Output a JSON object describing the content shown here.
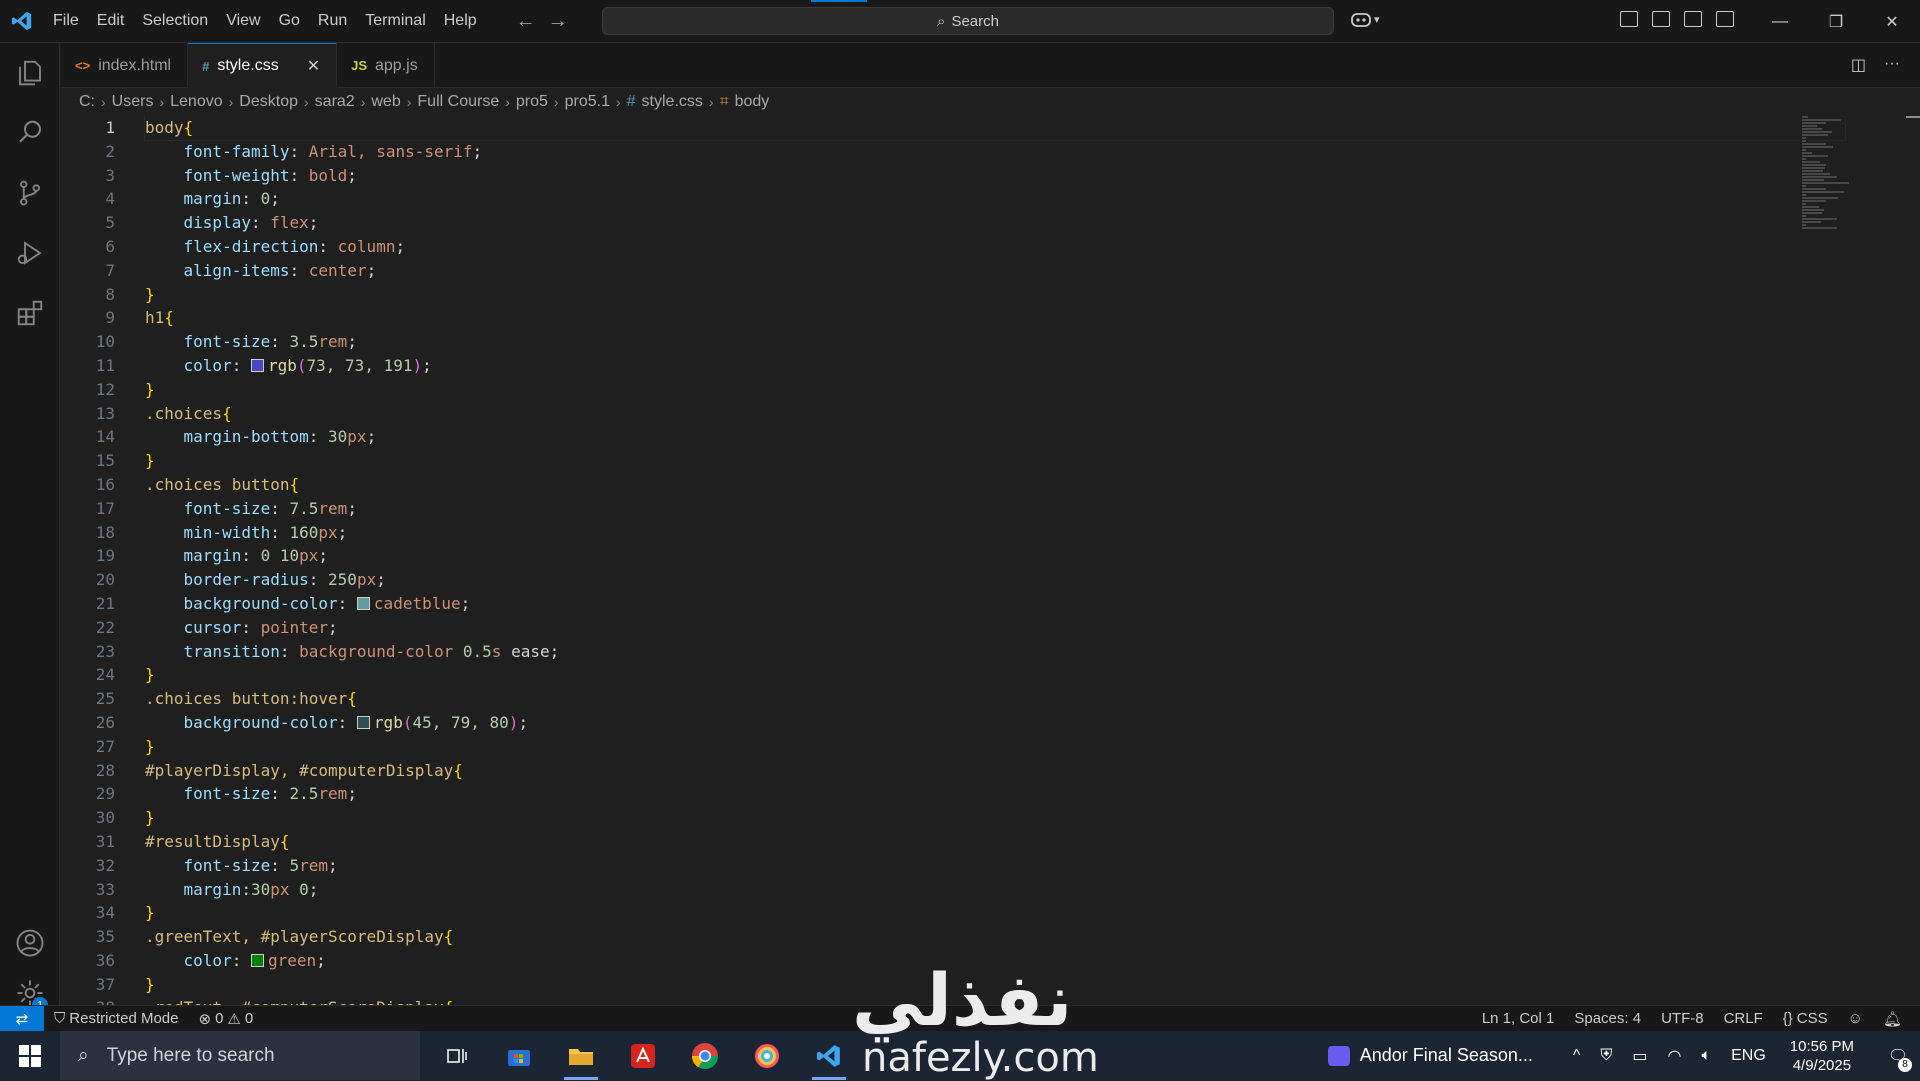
{
  "menu": [
    "File",
    "Edit",
    "Selection",
    "View",
    "Go",
    "Run",
    "Terminal",
    "Help"
  ],
  "command_center": {
    "label": "Search"
  },
  "tabs": [
    {
      "label": "index.html",
      "icon": "<>",
      "icon_color": "#e37933",
      "active": false
    },
    {
      "label": "style.css",
      "icon": "#",
      "icon_color": "#519aba",
      "active": true
    },
    {
      "label": "app.js",
      "icon": "JS",
      "icon_color": "#cbcb41",
      "active": false
    }
  ],
  "breadcrumb": [
    "C:",
    "Users",
    "Lenovo",
    "Desktop",
    "sara2",
    "web",
    "Full Course",
    "pro5",
    "pro5.1",
    "style.css",
    "body"
  ],
  "code_lines": [
    "body{",
    "    font-family: Arial, sans-serif;",
    "    font-weight: bold;",
    "    margin: 0;",
    "    display: flex;",
    "    flex-direction: column;",
    "    align-items: center;",
    "}",
    "h1{",
    "    font-size: 3.5rem;",
    "    color: rgb(73, 73, 191);",
    "}",
    ".choices{",
    "    margin-bottom: 30px;",
    "}",
    ".choices button{",
    "    font-size: 7.5rem;",
    "    min-width: 160px;",
    "    margin: 0 10px;",
    "    border-radius: 250px;",
    "    background-color: cadetblue;",
    "    cursor: pointer;",
    "    transition: background-color 0.5s ease;",
    "}",
    ".choices button:hover{",
    "    background-color: rgb(45, 79, 80);",
    "}",
    "#playerDisplay, #computerDisplay{",
    "    font-size: 2.5rem;",
    "}",
    "#resultDisplay{",
    "    font-size: 5rem;",
    "    margin:30px 0;",
    "}",
    ".greenText, #playerScoreDisplay{",
    "    color: green;",
    "}",
    ".redText, #computerScoreDisplay{"
  ],
  "color_swatches": {
    "11": "#4949bf",
    "21": "#5f9ea0",
    "26": "#2d4f50",
    "36": "#008000"
  },
  "statusbar": {
    "restricted": "Restricted Mode",
    "errors": "0",
    "warnings": "0",
    "position": "Ln 1, Col 1",
    "spaces": "Spaces: 4",
    "encoding": "UTF-8",
    "eol": "CRLF",
    "language": "CSS"
  },
  "watermark": {
    "text": "نفذلي",
    "url": "nafezly.com"
  },
  "taskbar": {
    "search_placeholder": "Type here to search",
    "media_title": "Andor Final Season...",
    "lang": "ENG",
    "time": "10:56 PM",
    "date": "4/9/2025",
    "notifications": "8"
  },
  "activity_badge": "1",
  "colors": {
    "accent": "#0078d4",
    "background": "#1f1f1f",
    "titlebar": "#181818"
  }
}
